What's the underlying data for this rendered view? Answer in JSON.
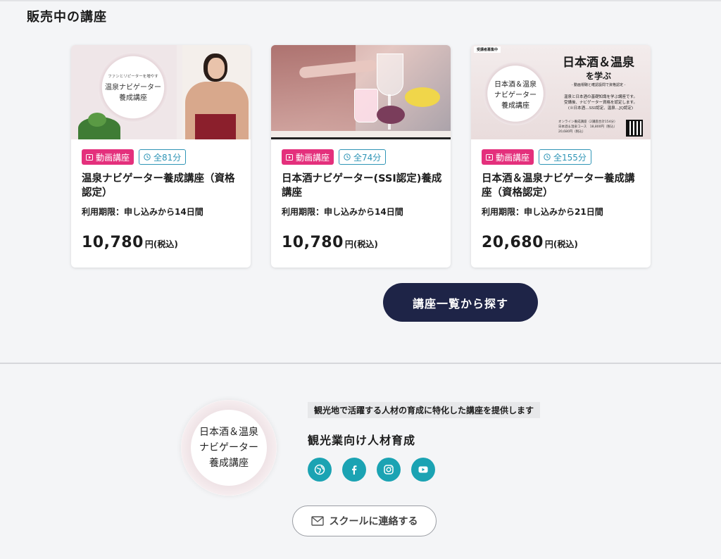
{
  "section": {
    "title": "販売中の講座"
  },
  "courses": [
    {
      "thumb_text": [
        "ファンとリピーターを増やす",
        "温泉ナビゲーター",
        "養成講座"
      ],
      "badge_type": "動画講座",
      "duration": "全81分",
      "title": "温泉ナビゲーター養成講座（資格認定）",
      "period": "利用期限：申し込みから14日間",
      "price": "10,780",
      "price_unit": "円(税込)"
    },
    {
      "badge_type": "動画講座",
      "duration": "全74分",
      "title": "日本酒ナビゲーター(SSI認定)養成講座",
      "period": "利用期限：申し込みから14日間",
      "price": "10,780",
      "price_unit": "円(税込)"
    },
    {
      "thumb_text": {
        "tag": "受講者募集中",
        "circle": [
          "日本酒＆温泉",
          "ナビゲーター",
          "養成講座"
        ],
        "headline1": "日本酒＆温泉",
        "headline2": "を学ぶ",
        "sub": "- 動画視聴と確認設問で資格認定 -",
        "body": [
          "温泉と日本酒の基礎知識を学ぶ講座です。",
          "受講後、ナビゲーター資格を認定します。",
          "(※日本酒…SSI認定、温泉…JQ認定)"
        ],
        "price_lines": [
          "オンライン養成講座（2講座合計154分）",
          "日本酒＆温泉コース　18,800円（税込）",
          "20,680円（税込）"
        ]
      },
      "badge_type": "動画講座",
      "duration": "全155分",
      "title": "日本酒＆温泉ナビゲーター養成講座（資格認定）",
      "period": "利用期限：申し込みから21日間",
      "price": "20,680",
      "price_unit": "円(税込)"
    }
  ],
  "browse_button": "講座一覧から探す",
  "footer": {
    "logo_lines": [
      "日本酒＆温泉",
      "ナビゲーター",
      "養成講座"
    ],
    "tagline": "観光地で活躍する人材の育成に特化した講座を提供します",
    "org_name": "観光業向け人材育成",
    "social": [
      "website-icon",
      "facebook-icon",
      "instagram-icon",
      "youtube-icon"
    ],
    "contact_button": "スクールに連絡する"
  },
  "colors": {
    "accent_pink": "#e4307c",
    "accent_teal": "#1ba3b3",
    "navy": "#1e2447"
  }
}
